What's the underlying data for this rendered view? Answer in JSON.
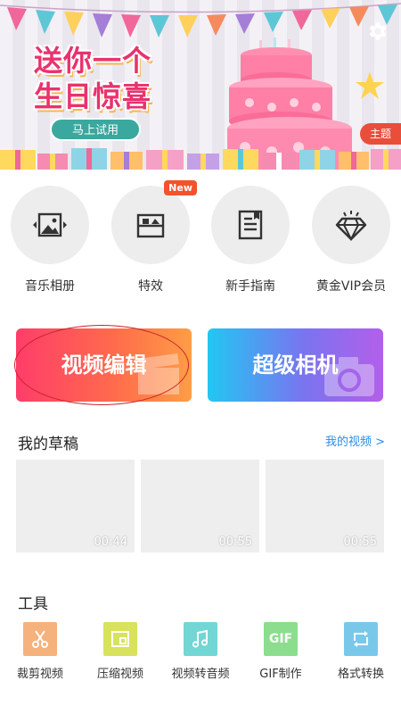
{
  "banner": {
    "title_line1": "送你一个",
    "title_line2": "生日惊喜",
    "try_button": "马上试用",
    "theme_tag": "主题",
    "colors": {
      "title": "#e8326e",
      "button": "#3aa89e",
      "tag": "#e94e3b"
    }
  },
  "features": [
    {
      "label": "音乐相册",
      "icon": "photo-icon"
    },
    {
      "label": "特效",
      "icon": "effects-icon",
      "badge": "New"
    },
    {
      "label": "新手指南",
      "icon": "book-icon"
    },
    {
      "label": "黄金VIP会员",
      "icon": "diamond-icon"
    }
  ],
  "cards": {
    "video_edit": "视频编辑",
    "super_camera": "超级相机"
  },
  "drafts": {
    "title": "我的草稿",
    "link": "我的视频 >",
    "items": [
      {
        "duration": "00:44"
      },
      {
        "duration": "00:55"
      },
      {
        "duration": "00:55"
      }
    ]
  },
  "tools": {
    "title": "工具",
    "items": [
      {
        "label": "裁剪视频",
        "icon": "scissors-icon",
        "color": "#f5b27c"
      },
      {
        "label": "压缩视频",
        "icon": "compress-icon",
        "color": "#d8e25d"
      },
      {
        "label": "视频转音频",
        "icon": "music-note-icon",
        "color": "#72d6d4"
      },
      {
        "label": "GIF制作",
        "icon": "gif-icon",
        "color": "#8cdd8e",
        "glyph": "GIF"
      },
      {
        "label": "格式转换",
        "icon": "convert-icon",
        "color": "#79c8ea"
      }
    ]
  }
}
